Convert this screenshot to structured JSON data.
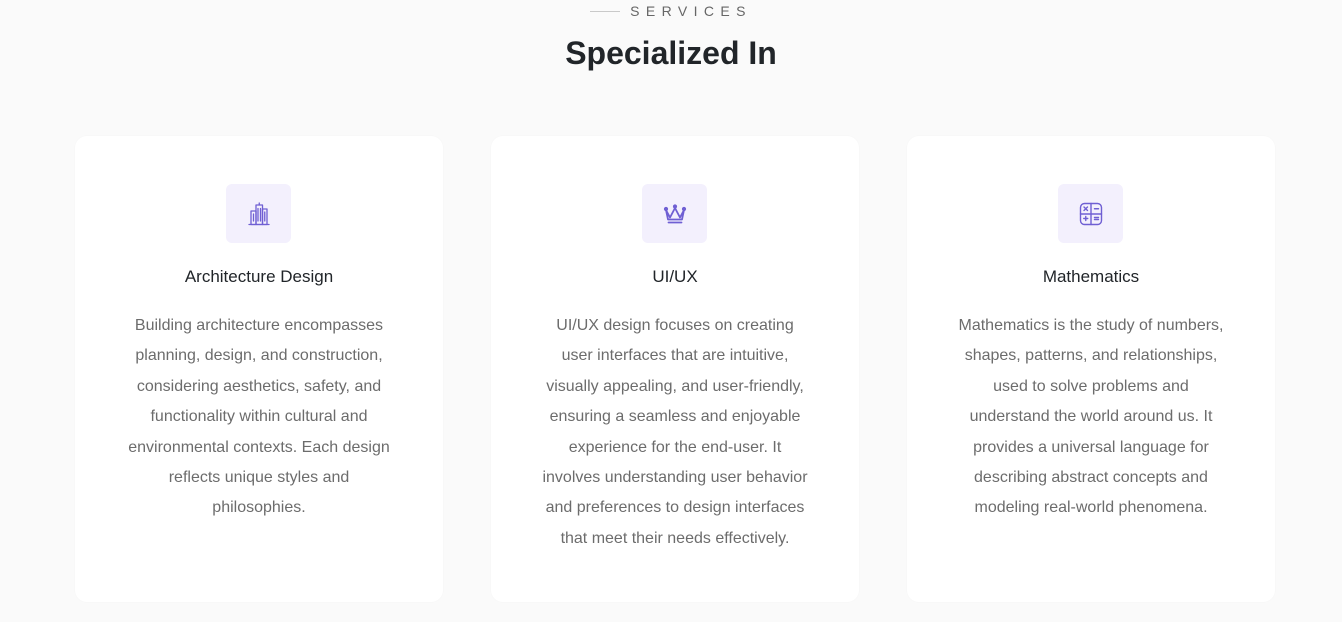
{
  "header": {
    "eyebrow": "SERVICES",
    "title": "Specialized In"
  },
  "colors": {
    "accent": "#6f5fd3",
    "icon_bg": "#f3f0fd",
    "page_bg": "#fafafa",
    "card_bg": "#ffffff"
  },
  "services": [
    {
      "icon": "building-icon",
      "title": "Architecture Design",
      "description": "Building architecture encompasses planning, design, and construction, considering aesthetics, safety, and functionality within cultural and environmental contexts. Each design reflects unique styles and philosophies."
    },
    {
      "icon": "crown-icon",
      "title": "UI/UX",
      "description": "UI/UX design focuses on creating user interfaces that are intuitive, visually appealing, and user-friendly, ensuring a seamless and enjoyable experience for the end-user. It involves understanding user behavior and preferences to design interfaces that meet their needs effectively."
    },
    {
      "icon": "calculator-icon",
      "title": "Mathematics",
      "description": "Mathematics is the study of numbers, shapes, patterns, and relationships, used to solve problems and understand the world around us. It provides a universal language for describing abstract concepts and modeling real-world phenomena."
    }
  ]
}
